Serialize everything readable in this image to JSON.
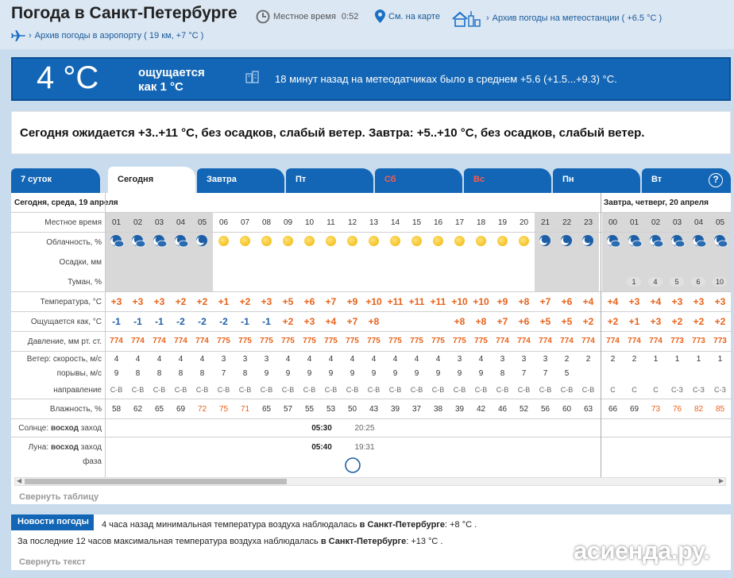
{
  "header": {
    "title": "Погода в Санкт-Петербурге",
    "local_time_label": "Местное время",
    "local_time": "0:52",
    "map_link": "См. на карте",
    "station_archive": "Архив погоды на метеостанции ( +6.5 °C )",
    "airport_archive": "Архив погоды в аэропорту ( 19 км, +7 °C )"
  },
  "now": {
    "temp": "4 °C",
    "feels_line1": "ощущается",
    "feels_line2": "как 1 °C",
    "sensors": "18 минут назад на метеодатчиках было в среднем +5.6 (+1.5...+9.3) °C."
  },
  "summary": "Сегодня ожидается +3..+11 °C, без осадков, слабый ветер. Завтра: +5..+10 °C, без осадков, слабый ветер.",
  "tabs": [
    "7 суток",
    "Сегодня",
    "Завтра",
    "Пт",
    "Сб",
    "Вс",
    "Пн",
    "Вт"
  ],
  "table": {
    "day1": "Сегодня, среда, 19 апреля",
    "day2": "Завтра, четверг, 20 апреля",
    "labels": {
      "time": "Местное время",
      "cloud": "Облачность, %",
      "precip": "Осадки, мм",
      "fog": "Туман, %",
      "temp": "Температура, °C",
      "feels": "Ощущается как, °C",
      "pressure": "Давление, мм рт. ст.",
      "wind": "Ветер: скорость, м/с",
      "gusts": "порывы, м/с",
      "direction": "направление",
      "humidity": "Влажность, %",
      "sun": "Солнце:",
      "sun_bold": "восход",
      "sun_set": "заход",
      "moon": "Луна:",
      "moon_bold": "восход",
      "moon_set": "заход",
      "phase": "фаза"
    },
    "hours": [
      "01",
      "02",
      "03",
      "04",
      "05",
      "06",
      "07",
      "08",
      "09",
      "10",
      "11",
      "12",
      "13",
      "14",
      "15",
      "16",
      "17",
      "18",
      "19",
      "20",
      "21",
      "22",
      "23",
      "00",
      "01",
      "02",
      "03",
      "04",
      "05"
    ],
    "sky": [
      "moon-cloud-icon",
      "moon-cloud-icon",
      "moon-cloud-icon",
      "moon-cloud-icon",
      "moon-icon",
      "sun-rise-icon",
      "sun-icon",
      "sun-icon",
      "sun-icon",
      "sun-icon",
      "sun-icon",
      "sun-icon",
      "sun-icon",
      "sun-icon",
      "sun-icon",
      "sun-icon",
      "sun-icon",
      "sun-icon",
      "sun-icon",
      "sun-icon",
      "moon-icon",
      "moon-icon",
      "moon-icon",
      "moon-cloud-icon",
      "moon-cloud-icon",
      "moon-cloud-icon",
      "moon-cloud-icon",
      "moon-cloud-icon",
      "moon-cloud-icon"
    ],
    "fog": [
      "",
      "",
      "",
      "",
      "",
      "",
      "",
      "",
      "",
      "",
      "",
      "",
      "",
      "",
      "",
      "",
      "",
      "",
      "",
      "",
      "",
      "",
      "",
      "",
      "1",
      "4",
      "5",
      "6",
      "10"
    ],
    "temp": [
      "+3",
      "+3",
      "+3",
      "+2",
      "+2",
      "+1",
      "+2",
      "+3",
      "+5",
      "+6",
      "+7",
      "+9",
      "+10",
      "+11",
      "+11",
      "+11",
      "+10",
      "+10",
      "+9",
      "+8",
      "+7",
      "+6",
      "+4",
      "+4",
      "+3",
      "+4",
      "+3",
      "+3",
      "+3"
    ],
    "feels": [
      "-1",
      "-1",
      "-1",
      "-2",
      "-2",
      "-2",
      "-1",
      "-1",
      "+2",
      "+3",
      "+4",
      "+7",
      "+8",
      "",
      "",
      "",
      "+8",
      "+8",
      "+7",
      "+6",
      "+5",
      "+5",
      "+2",
      "+2",
      "+1",
      "+3",
      "+2",
      "+2",
      "+2"
    ],
    "pressure": [
      "774",
      "774",
      "774",
      "774",
      "774",
      "775",
      "775",
      "775",
      "775",
      "775",
      "775",
      "775",
      "775",
      "775",
      "775",
      "775",
      "775",
      "775",
      "774",
      "774",
      "774",
      "774",
      "774",
      "774",
      "774",
      "774",
      "773",
      "773",
      "773"
    ],
    "wind": [
      "4",
      "4",
      "4",
      "4",
      "4",
      "3",
      "3",
      "3",
      "4",
      "4",
      "4",
      "4",
      "4",
      "4",
      "4",
      "4",
      "3",
      "4",
      "3",
      "3",
      "3",
      "2",
      "2",
      "2",
      "2",
      "1",
      "1",
      "1",
      "1"
    ],
    "gusts": [
      "9",
      "8",
      "8",
      "8",
      "8",
      "7",
      "8",
      "9",
      "9",
      "9",
      "9",
      "9",
      "9",
      "9",
      "9",
      "9",
      "9",
      "9",
      "8",
      "7",
      "7",
      "5",
      "",
      "",
      "",
      "",
      "",
      "",
      ""
    ],
    "direction": [
      "С-В",
      "С-В",
      "С-В",
      "С-В",
      "С-В",
      "С-В",
      "С-В",
      "С-В",
      "С-В",
      "С-В",
      "С-В",
      "С-В",
      "С-В",
      "С-В",
      "С-В",
      "С-В",
      "С-В",
      "С-В",
      "С-В",
      "С-В",
      "С-В",
      "С-В",
      "С-В",
      "С",
      "С",
      "С",
      "С-З",
      "С-З",
      "С-З"
    ],
    "humidity": [
      "58",
      "62",
      "65",
      "69",
      "72",
      "75",
      "71",
      "65",
      "57",
      "55",
      "53",
      "50",
      "43",
      "39",
      "37",
      "38",
      "39",
      "42",
      "46",
      "52",
      "56",
      "60",
      "63",
      "66",
      "69",
      "73",
      "76",
      "82",
      "85"
    ],
    "sunrise": "05:30",
    "sunset": "20:25",
    "moonrise": "05:40",
    "moonset": "19:31",
    "collapse": "Свернуть таблицу"
  },
  "news": {
    "tab": "Новости погоды",
    "line1_a": "4 часа назад минимальная температура воздуха наблюдалась",
    "line1_b": "в Санкт-Петербурге",
    "line1_c": ": +8 °C .",
    "line2_a": "За последние 12 часов максимальная температура воздуха наблюдалась",
    "line2_b": "в Санкт-Петербурге",
    "line2_c": ": +13 °C .",
    "collapse": "Свернуть текст"
  },
  "watermark": "асиенда.ру.",
  "colors": {
    "blue": "#1366b5",
    "orange": "#e8621a",
    "page_bg": "#c9dcee"
  }
}
